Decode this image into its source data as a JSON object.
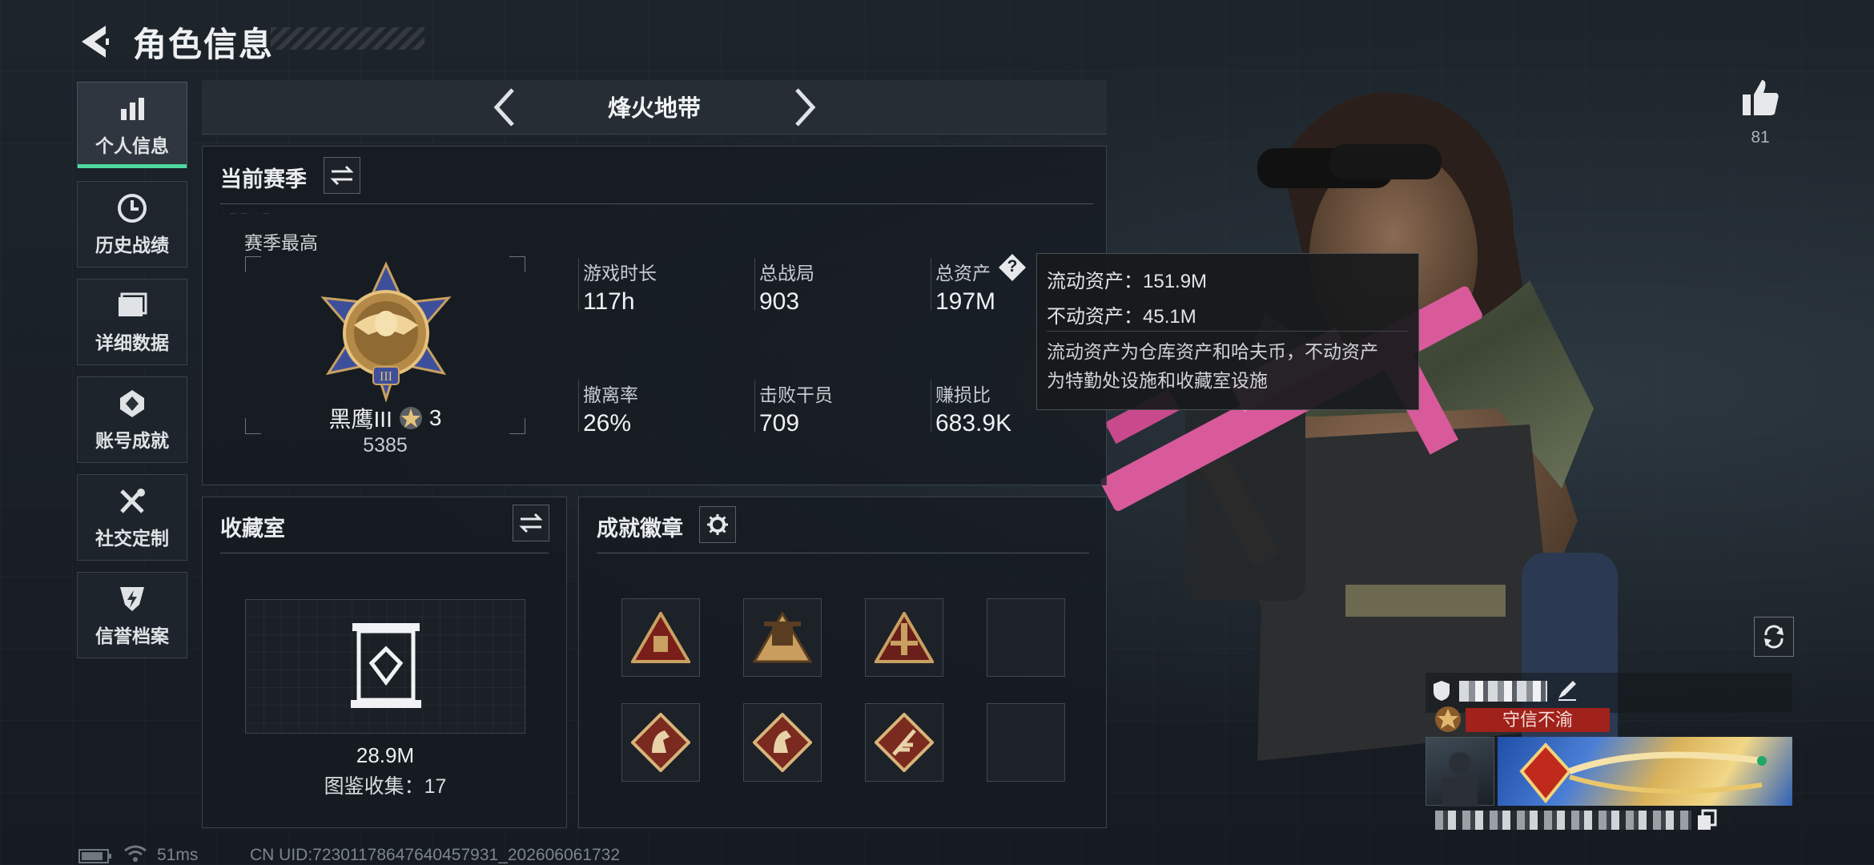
{
  "header": {
    "title": "角色信息"
  },
  "sidebar": {
    "items": [
      {
        "label": "个人信息",
        "icon": "bar-chart-icon",
        "active": true
      },
      {
        "label": "历史战绩",
        "icon": "clock-icon",
        "active": false
      },
      {
        "label": "详细数据",
        "icon": "folder-icon",
        "active": false
      },
      {
        "label": "账号成就",
        "icon": "medal-icon",
        "active": false
      },
      {
        "label": "社交定制",
        "icon": "tools-icon",
        "active": false
      },
      {
        "label": "信誉档案",
        "icon": "shield-bolt-icon",
        "active": false
      }
    ]
  },
  "mode": {
    "title": "烽火地带"
  },
  "season": {
    "title": "当前赛季",
    "best_label": "赛季最高",
    "rank_name": "黑鹰III",
    "rank_stars": "3",
    "rank_score": "5385",
    "stats": [
      {
        "label": "游戏时长",
        "value": "117h"
      },
      {
        "label": "总战局",
        "value": "903"
      },
      {
        "label": "总资产",
        "value": "197M"
      },
      {
        "label": "撤离率",
        "value": "26%"
      },
      {
        "label": "击败干员",
        "value": "709"
      },
      {
        "label": "赚损比",
        "value": "683.9K"
      }
    ],
    "help_glyph": "?"
  },
  "tooltip": {
    "liquid": "流动资产：151.9M",
    "fixed": "不动资产：45.1M",
    "desc_1": "流动资产为仓库资产和哈夫币，不动资产",
    "desc_2": "为特勤处设施和收藏室设施"
  },
  "collection": {
    "title": "收藏室",
    "value": "28.9M",
    "catalog": "图鉴收集：17"
  },
  "achievements": {
    "title": "成就徽章",
    "badges": [
      "triangle-badge-1",
      "triangle-badge-2",
      "triangle-badge-3",
      "empty",
      "diamond-horse-badge-1",
      "diamond-horse-badge-2",
      "diamond-feather-badge",
      "empty"
    ]
  },
  "likes": {
    "count": "81"
  },
  "player_card": {
    "title_badge": "守信不渝"
  },
  "status_bar": {
    "ping": "51ms",
    "uid": "CN UID:72301178647640457931_202606061732"
  },
  "colors": {
    "accent": "#4fd9a0",
    "gold": "#c8a062",
    "tooltip_bg": "#181a1c",
    "red_banner": "#a1211b"
  }
}
